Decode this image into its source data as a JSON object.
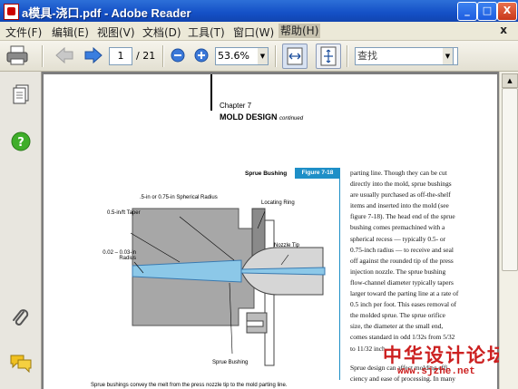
{
  "window": {
    "title": "a模具-浇口.pdf - Adobe Reader",
    "buttons": {
      "minimize": "_",
      "maximize": "□",
      "close": "X"
    }
  },
  "menubar": {
    "items": [
      "文件(F)",
      "编辑(E)",
      "视图(V)",
      "文档(D)",
      "工具(T)",
      "窗口(W)",
      "帮助(H)"
    ],
    "close_doc": "x"
  },
  "toolbar": {
    "page_current": "1",
    "page_total": "/ 21",
    "zoom": "53.6%",
    "search_placeholder": "查找",
    "dropdown_arrow": "▼"
  },
  "document": {
    "chapter": "Chapter 7",
    "heading": "MOLD DESIGN",
    "heading_suffix": "continued",
    "figure": {
      "caption_left": "Sprue Bushing",
      "tag": "Figure 7-18",
      "labels": {
        "radius": ".5-in or 0.75-in Spherical Radius",
        "taper": "0.5-in/ft Taper",
        "locating_ring": "Locating Ring",
        "nozzle_tip": "Nozzle Tip",
        "orifice_radius": "0.02 – 0.03-in Radius",
        "sprue_bushing": "Sprue Bushing"
      },
      "footer_caption": "Sprue bushings convey the melt from the press nozzle tip to the mold parting line."
    },
    "body_lines": [
      "parting line. Though they can be cut",
      "directly into the mold, sprue bushings",
      "are usually purchased as off-the-shelf",
      "items and inserted into the mold (see",
      "figure 7-18). The head end of the sprue",
      "bushing comes premachined with a",
      "spherical recess — typically 0.5- or",
      "0.75-inch radius — to receive and seal",
      "off against the rounded tip of the press",
      "injection nozzle. The sprue bushing",
      "flow-channel diameter typically tapers",
      "larger toward the parting line at a rate of",
      "0.5 inch per foot. This eases removal of",
      "the molded sprue. The sprue orifice",
      "size, the diameter at the small end,",
      "comes standard in odd 1/32s from 5/32",
      "to 11/32 inch."
    ],
    "body_lines_2": [
      "Sprue design can affect molding effi-",
      "ciency and ease of processing. In many"
    ]
  },
  "watermark": {
    "line1": "中华设计论坛",
    "line2": "www.sjzhe.net"
  },
  "colors": {
    "title_bar": "#1450c6",
    "figure_tag": "#1e8fc7",
    "flow_channel": "#8cc8e8",
    "mold_gray": "#a0a0a0",
    "watermark": "#cc2020"
  }
}
